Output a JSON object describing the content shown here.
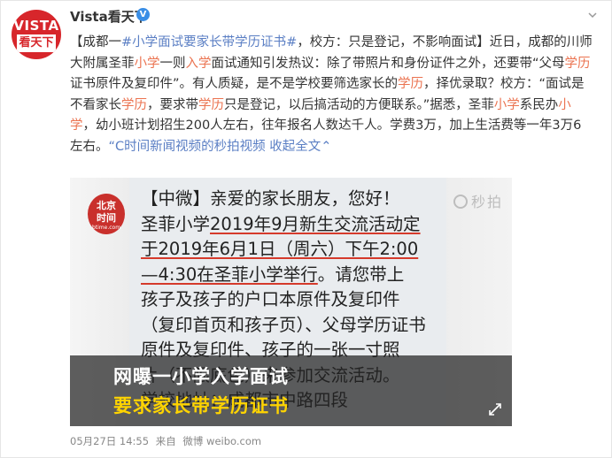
{
  "post": {
    "user_name": "Vista看天下",
    "avatar_top": "VISTA",
    "avatar_bottom": "看天下",
    "verified_mark": "V",
    "dropdown_icon": "chevron-down-icon",
    "text_segments": [
      {
        "t": "【成都一",
        "c": "n"
      },
      {
        "t": "#小学面试要家长带学历证书#",
        "c": "l"
      },
      {
        "t": "，校方：只是登记，不影响面试】近日，成都的川师大附属圣菲",
        "c": "n"
      },
      {
        "t": "小学",
        "c": "h"
      },
      {
        "t": "一则",
        "c": "n"
      },
      {
        "t": "入学",
        "c": "h"
      },
      {
        "t": "面试通知引发热议：除了带照片和身份证件之外，还要带“父母",
        "c": "n"
      },
      {
        "t": "学历",
        "c": "h"
      },
      {
        "t": "证书原件及复印件”。有人质疑，是不是学校要筛选家长的",
        "c": "n"
      },
      {
        "t": "学历",
        "c": "h"
      },
      {
        "t": "，择优录取？校方：“面试是不看家长",
        "c": "n"
      },
      {
        "t": "学历",
        "c": "h"
      },
      {
        "t": "，要求带",
        "c": "n"
      },
      {
        "t": "学历",
        "c": "h"
      },
      {
        "t": "只是登记，以后搞活动的方便联系。”据悉，圣菲",
        "c": "n"
      },
      {
        "t": "小学",
        "c": "h"
      },
      {
        "t": "系民办",
        "c": "n"
      },
      {
        "t": "小学",
        "c": "h"
      },
      {
        "t": "，幼小班计划招生200人左右，往年报名人数达千人。学费3万，加上生活费等一年3万6左右。",
        "c": "n"
      },
      {
        "t": "“C时间新闻视频的秒拍视频",
        "c": "l"
      },
      {
        "t": " ",
        "c": "n"
      },
      {
        "t": "收起全文⌃",
        "c": "l"
      }
    ]
  },
  "video": {
    "sms_lines": [
      {
        "t": "【中微】亲爱的家长朋友，您好！",
        "u": false
      },
      {
        "t": "圣菲小学",
        "u": false,
        "tail": "2019年9月新生交流活动定"
      },
      {
        "t": "于2019年6月1日（周六）下午2:00",
        "u": true
      },
      {
        "t": "—4:30在圣菲小学举行",
        "u": true,
        "tail2": "。请您带上"
      },
      {
        "t": "孩子及孩子的户口本原件及复印件",
        "u": false
      },
      {
        "t": "（复印首页和孩子页）、父母学历证书",
        "u": false
      },
      {
        "t": "原件及复印件、孩子的一张一寸照",
        "u": false
      },
      {
        "t": "片（不限底色）来参加交流活动。",
        "u": false
      },
      {
        "t": "学校地址：成都市中路四段",
        "u": false
      }
    ],
    "logo_line1": "北京",
    "logo_line2": "时间",
    "logo_small": "btime.com",
    "watermark": "秒拍",
    "caption_line1": "网曝一小学入学面试",
    "caption_line2": "要求家长带学历证书",
    "fullscreen_icon": "fullscreen-icon"
  },
  "meta": {
    "date": "05月27日 14:55",
    "source_prefix": "来自",
    "source": "微博 weibo.com"
  }
}
